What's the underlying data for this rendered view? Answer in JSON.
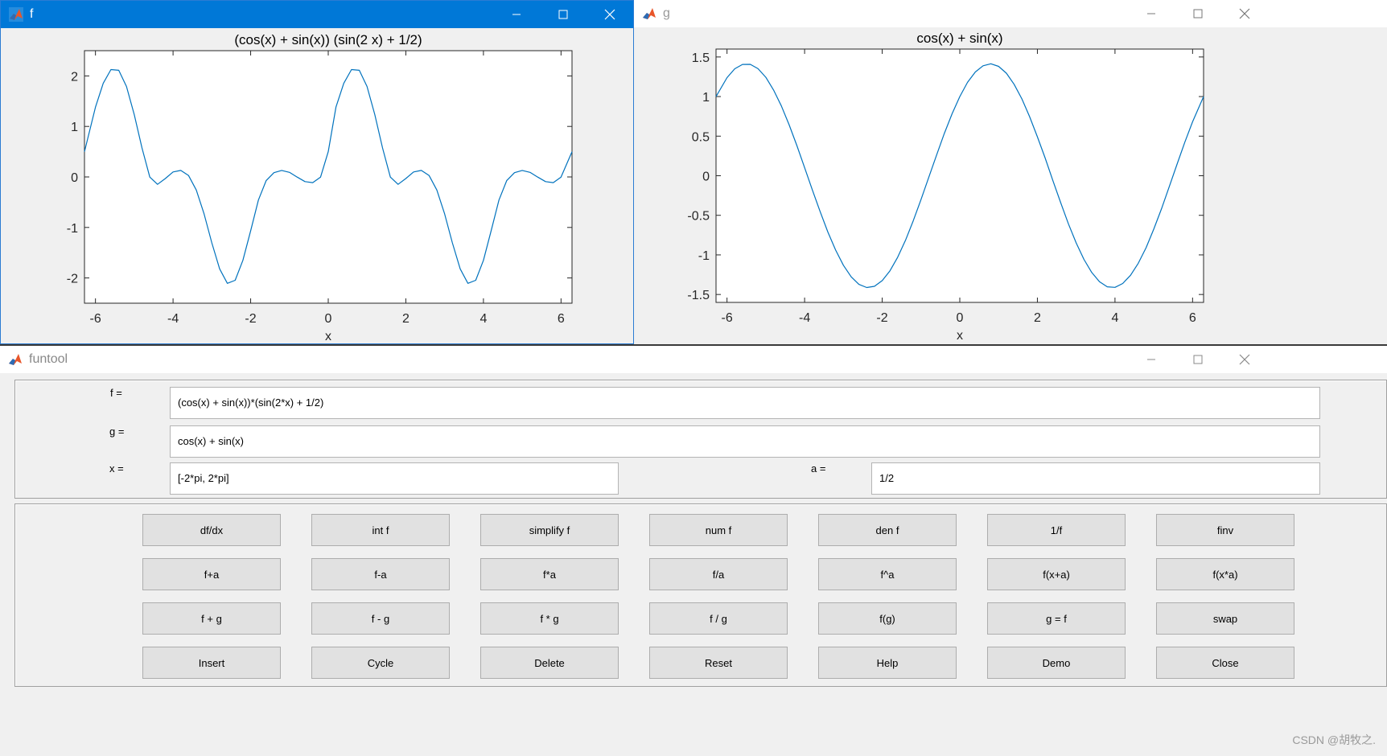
{
  "window_f": {
    "title": "f",
    "plot": {
      "title": "(cos(x) + sin(x)) (sin(2 x) + 1/2)",
      "xlabel": "x",
      "xticks": [
        "-6",
        "-4",
        "-2",
        "0",
        "2",
        "4",
        "6"
      ],
      "yticks": [
        "2",
        "1",
        "0",
        "-1",
        "-2"
      ]
    }
  },
  "window_g": {
    "title": "g",
    "plot": {
      "title": "cos(x) + sin(x)",
      "xlabel": "x",
      "xticks": [
        "-6",
        "-4",
        "-2",
        "0",
        "2",
        "4",
        "6"
      ],
      "yticks": [
        "1.5",
        "1",
        "0.5",
        "0",
        "-0.5",
        "-1",
        "-1.5"
      ]
    }
  },
  "funtool": {
    "title": "funtool",
    "f_label": "f =",
    "f_value": "(cos(x) + sin(x))*(sin(2*x) + 1/2)",
    "g_label": "g =",
    "g_value": "cos(x) + sin(x)",
    "x_label": "x =",
    "x_value": "[-2*pi, 2*pi]",
    "a_label": "a =",
    "a_value": "1/2",
    "buttons": [
      [
        "df/dx",
        "int f",
        "simplify f",
        "num f",
        "den f",
        "1/f",
        "finv"
      ],
      [
        "f+a",
        "f-a",
        "f*a",
        "f/a",
        "f^a",
        "f(x+a)",
        "f(x*a)"
      ],
      [
        "f + g",
        "f - g",
        "f * g",
        "f / g",
        "f(g)",
        "g = f",
        "swap"
      ],
      [
        "Insert",
        "Cycle",
        "Delete",
        "Reset",
        "Help",
        "Demo",
        "Close"
      ]
    ]
  },
  "watermark": "CSDN @胡牧之.",
  "chart_data": [
    {
      "type": "line",
      "title": "(cos(x) + sin(x)) (sin(2 x) + 1/2)",
      "xlabel": "x",
      "ylabel": "",
      "xlim": [
        -6.2832,
        6.2832
      ],
      "ylim": [
        -2.5,
        2.5
      ],
      "series": [
        {
          "color": "#0072bd",
          "x": [
            -6.283,
            -6.0,
            -5.8,
            -5.6,
            -5.4,
            -5.2,
            -5.0,
            -4.8,
            -4.6,
            -4.4,
            -4.2,
            -4.0,
            -3.8,
            -3.6,
            -3.4,
            -3.2,
            -3.0,
            -2.8,
            -2.6,
            -2.4,
            -2.2,
            -2.0,
            -1.8,
            -1.6,
            -1.4,
            -1.2,
            -1.0,
            -0.8,
            -0.6,
            -0.4,
            -0.2,
            0.0,
            0.2,
            0.4,
            0.6,
            0.8,
            1.0,
            1.2,
            1.4,
            1.6,
            1.8,
            2.0,
            2.2,
            2.4,
            2.6,
            2.8,
            3.0,
            3.2,
            3.4,
            3.6,
            3.8,
            4.0,
            4.2,
            4.4,
            4.6,
            4.8,
            5.0,
            5.2,
            5.4,
            5.6,
            5.8,
            6.0,
            6.283
          ],
          "y": [
            0.5,
            1.384,
            1.854,
            2.126,
            2.111,
            1.792,
            1.233,
            0.574,
            -0.003,
            -0.146,
            -0.032,
            0.099,
            0.129,
            0.027,
            -0.26,
            -0.734,
            -1.305,
            -1.82,
            -2.107,
            -2.046,
            -1.652,
            -1.063,
            -0.457,
            -0.074,
            0.085,
            0.129,
            0.091,
            -0.003,
            -0.093,
            -0.113,
            -0.004,
            0.5,
            1.384,
            1.854,
            2.126,
            2.111,
            1.792,
            1.233,
            0.574,
            -0.003,
            -0.146,
            -0.032,
            0.099,
            0.129,
            0.027,
            -0.26,
            -0.734,
            -1.305,
            -1.82,
            -2.107,
            -2.046,
            -1.652,
            -1.063,
            -0.457,
            -0.074,
            0.085,
            0.129,
            0.091,
            -0.003,
            -0.093,
            -0.113,
            -0.004,
            0.5
          ]
        }
      ]
    },
    {
      "type": "line",
      "title": "cos(x) + sin(x)",
      "xlabel": "x",
      "ylabel": "",
      "xlim": [
        -6.2832,
        6.2832
      ],
      "ylim": [
        -1.6,
        1.6
      ],
      "series": [
        {
          "color": "#0072bd",
          "x": [
            -6.283,
            -6.0,
            -5.8,
            -5.6,
            -5.4,
            -5.2,
            -5.0,
            -4.8,
            -4.6,
            -4.4,
            -4.2,
            -4.0,
            -3.8,
            -3.6,
            -3.4,
            -3.2,
            -3.0,
            -2.8,
            -2.6,
            -2.4,
            -2.2,
            -2.0,
            -1.8,
            -1.6,
            -1.4,
            -1.2,
            -1.0,
            -0.8,
            -0.6,
            -0.4,
            -0.2,
            0.0,
            0.2,
            0.4,
            0.6,
            0.8,
            1.0,
            1.2,
            1.4,
            1.6,
            1.8,
            2.0,
            2.2,
            2.4,
            2.6,
            2.8,
            3.0,
            3.2,
            3.4,
            3.6,
            3.8,
            4.0,
            4.2,
            4.4,
            4.6,
            4.8,
            5.0,
            5.2,
            5.4,
            5.6,
            5.8,
            6.0,
            6.283
          ],
          "y": [
            1.0,
            1.239,
            1.351,
            1.406,
            1.407,
            1.352,
            1.243,
            1.083,
            0.882,
            0.645,
            0.381,
            0.103,
            -0.179,
            -0.453,
            -0.711,
            -0.94,
            -1.131,
            -1.277,
            -1.372,
            -1.412,
            -1.397,
            -1.325,
            -1.201,
            -1.029,
            -0.816,
            -0.57,
            -0.301,
            -0.021,
            0.26,
            0.532,
            0.782,
            1.0,
            1.179,
            1.31,
            1.389,
            1.414,
            1.382,
            1.295,
            1.155,
            0.97,
            0.746,
            0.493,
            0.223,
            -0.062,
            -0.34,
            -0.607,
            -0.849,
            -1.057,
            -1.222,
            -1.339,
            -1.403,
            -1.41,
            -1.361,
            -1.258,
            -1.106,
            -0.91,
            -0.675,
            -0.415,
            -0.136,
            0.147,
            0.424,
            0.681,
            1.0
          ]
        }
      ]
    }
  ]
}
